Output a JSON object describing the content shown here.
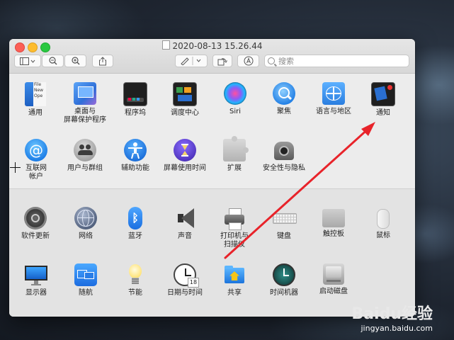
{
  "window": {
    "title": "2020-08-13 15.26.44",
    "search_placeholder": "搜索"
  },
  "toolbar": {
    "sidebar_icon": "sidebar-icon",
    "zoom_out_icon": "zoom-out-icon",
    "zoom_in_icon": "zoom-in-icon",
    "share_icon": "share-icon",
    "markup_icon": "markup-pen-icon",
    "rotate_icon": "rotate-icon",
    "annotate_icon": "annotate-icon"
  },
  "prefs_row1": [
    {
      "label": "通用",
      "icon": "general-icon"
    },
    {
      "label": "桌面与\n屏幕保护程序",
      "icon": "desktop-icon"
    },
    {
      "label": "程序坞",
      "icon": "dock-icon"
    },
    {
      "label": "调度中心",
      "icon": "mission-control-icon"
    },
    {
      "label": "Siri",
      "icon": "siri-icon"
    },
    {
      "label": "聚焦",
      "icon": "spotlight-icon"
    },
    {
      "label": "语言与地区",
      "icon": "language-region-icon"
    },
    {
      "label": "通知",
      "icon": "notifications-icon"
    }
  ],
  "prefs_row2": [
    {
      "label": "互联网\n帐户",
      "icon": "internet-accounts-icon"
    },
    {
      "label": "用户与群组",
      "icon": "users-groups-icon"
    },
    {
      "label": "辅助功能",
      "icon": "accessibility-icon"
    },
    {
      "label": "屏幕使用时间",
      "icon": "screen-time-icon"
    },
    {
      "label": "扩展",
      "icon": "extensions-icon"
    },
    {
      "label": "安全性与隐私",
      "icon": "security-icon"
    }
  ],
  "prefs_row3": [
    {
      "label": "软件更新",
      "icon": "software-update-icon"
    },
    {
      "label": "网络",
      "icon": "network-icon"
    },
    {
      "label": "蓝牙",
      "icon": "bluetooth-icon"
    },
    {
      "label": "声音",
      "icon": "sound-icon"
    },
    {
      "label": "打印机与\n扫描仪",
      "icon": "printers-icon"
    },
    {
      "label": "键盘",
      "icon": "keyboard-icon"
    },
    {
      "label": "触控板",
      "icon": "trackpad-icon"
    },
    {
      "label": "鼠标",
      "icon": "mouse-icon"
    }
  ],
  "prefs_row4": [
    {
      "label": "显示器",
      "icon": "displays-icon"
    },
    {
      "label": "随航",
      "icon": "sidecar-icon"
    },
    {
      "label": "节能",
      "icon": "energy-saver-icon"
    },
    {
      "label": "日期与时间",
      "icon": "date-time-icon"
    },
    {
      "label": "共享",
      "icon": "sharing-icon"
    },
    {
      "label": "时间机器",
      "icon": "time-machine-icon"
    },
    {
      "label": "启动磁盘",
      "icon": "startup-disk-icon"
    }
  ],
  "date_icon_day": "18",
  "general_icon_text": "File\nNew\nOpe",
  "watermark": {
    "brand": "Baidu经验",
    "url": "jingyan.baidu.com"
  },
  "colors": {
    "arrow": "#e8232a",
    "accent": "#2d84f4"
  }
}
